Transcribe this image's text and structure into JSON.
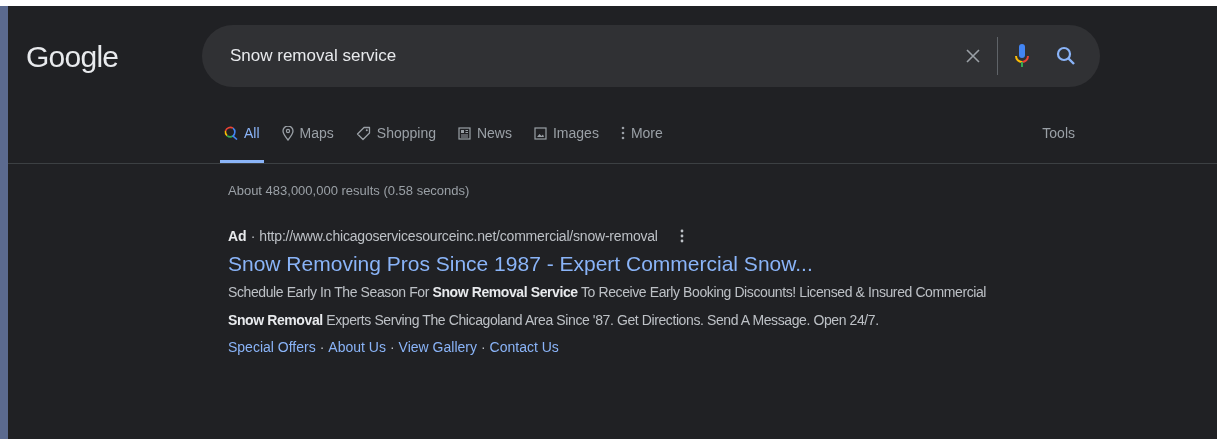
{
  "logo": "Google",
  "search": {
    "value": "Snow removal service"
  },
  "tabs": [
    {
      "label": "All",
      "kind": "search",
      "selected": true
    },
    {
      "label": "Maps",
      "kind": "pin",
      "selected": false
    },
    {
      "label": "Shopping",
      "kind": "tag",
      "selected": false
    },
    {
      "label": "News",
      "kind": "news",
      "selected": false
    },
    {
      "label": "Images",
      "kind": "image",
      "selected": false
    },
    {
      "label": "More",
      "kind": "dots",
      "selected": false
    }
  ],
  "tools": "Tools",
  "result_stats": "About 483,000,000 results (0.58 seconds)",
  "ad": {
    "label": "Ad",
    "separator": "·",
    "url": "http://www.chicagoservicesourceinc.net/commercial/snow-removal",
    "title": "Snow Removing Pros Since 1987 - Expert Commercial Snow...",
    "description": "Schedule Early In The Season For **Snow Removal Service** To Receive Early Booking Discounts! Licensed & Insured Commercial **Snow Removal** Experts Serving The Chicagoland Area Since '87. Get Directions. Send A Message. Open 24/7.",
    "sitelinks": [
      {
        "kind": "link",
        "text": "Special Offers"
      },
      {
        "kind": "separator",
        "text": "·"
      },
      {
        "kind": "link",
        "text": "About Us"
      },
      {
        "kind": "separator",
        "text": "·"
      },
      {
        "kind": "link",
        "text": "View Gallery"
      },
      {
        "kind": "separator",
        "text": "·"
      },
      {
        "kind": "link",
        "text": "Contact Us"
      }
    ]
  }
}
